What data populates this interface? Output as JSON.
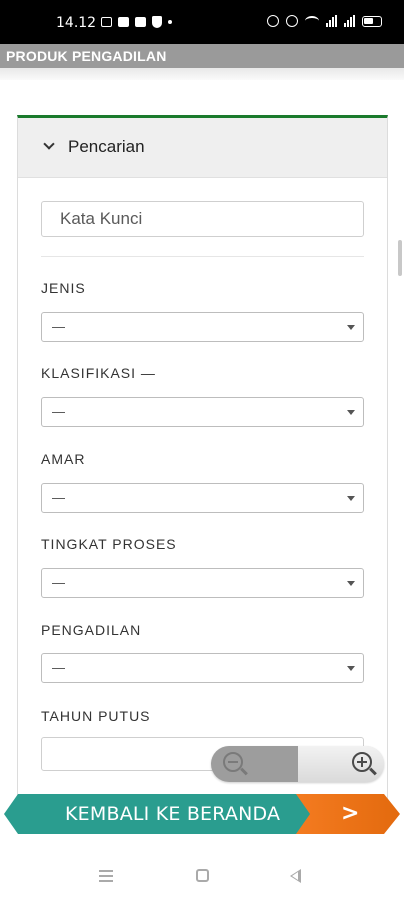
{
  "status_bar": {
    "time": "14.12",
    "left_icons": [
      "mail-icon",
      "facebook-icon",
      "robot-icon",
      "shield-icon",
      "dot-icon"
    ],
    "right_icons": [
      "mute-icon",
      "alarm-icon",
      "wifi-icon",
      "signal-icon",
      "battery-icon"
    ]
  },
  "app_bar": {
    "title": "PRODUK PENGADILAN"
  },
  "search_panel": {
    "header_title": "Pencarian",
    "keyword_placeholder": "Kata Kunci",
    "fields": [
      {
        "label": "JENIS",
        "value": "—",
        "type": "select"
      },
      {
        "label": "KLASIFIKASI —",
        "value": "—",
        "type": "select"
      },
      {
        "label": "AMAR",
        "value": "—",
        "type": "select"
      },
      {
        "label": "TINGKAT PROSES",
        "value": "—",
        "type": "select"
      },
      {
        "label": "PENGADILAN",
        "value": "—",
        "type": "select"
      },
      {
        "label": "TAHUN PUTUS",
        "value": "",
        "type": "text"
      }
    ]
  },
  "zoom_controls": {
    "zoom_out_icon": "zoom-out-icon",
    "zoom_in_icon": "zoom-in-icon"
  },
  "home_banner": {
    "label": "KEMBALI KE BERANDA",
    "arrow": ">",
    "colors": {
      "primary": "#2a9d8f",
      "accent": "#f47b20"
    }
  },
  "colors": {
    "header_accent": "#1a7a2c",
    "title_bar": "#9a9a9a"
  }
}
